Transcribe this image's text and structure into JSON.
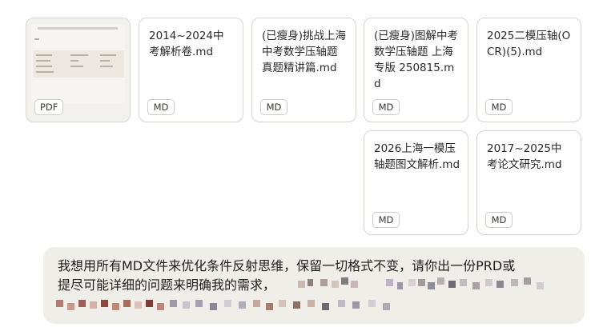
{
  "attachments": [
    {
      "kind": "pdf",
      "badge": "PDF"
    },
    {
      "name": "2014~2024中考解析卷.md",
      "badge": "MD"
    },
    {
      "name": "(已瘦身)挑战上海中考数学压轴题真题精讲篇.md",
      "badge": "MD"
    },
    {
      "name": "(已瘦身)图解中考数学压轴题 上海专版 250815.md",
      "badge": "MD"
    },
    {
      "name": "2025二模压轴(OCR)(5).md",
      "badge": "MD"
    },
    {
      "name": "2026上海一模压轴题图文解析.md",
      "badge": "MD"
    },
    {
      "name": "2017~2025中考论文研究.md",
      "badge": "MD"
    }
  ],
  "message": {
    "line1": "我想用所有MD文件来优化条件反射思维，保留一切格式不变，请你出一份PRD或",
    "line2": "提尽可能详细的问题来明确我的需求，"
  }
}
